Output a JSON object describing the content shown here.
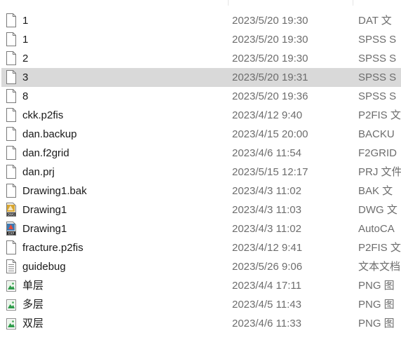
{
  "files": [
    {
      "name": "1",
      "date": "2023/5/20 19:30",
      "type": "DAT 文",
      "icon": "blank-file-icon",
      "selected": false
    },
    {
      "name": "1",
      "date": "2023/5/20 19:30",
      "type": "SPSS S",
      "icon": "blank-file-icon",
      "selected": false
    },
    {
      "name": "2",
      "date": "2023/5/20 19:30",
      "type": "SPSS S",
      "icon": "blank-file-icon",
      "selected": false
    },
    {
      "name": "3",
      "date": "2023/5/20 19:31",
      "type": "SPSS S",
      "icon": "blank-file-icon",
      "selected": true
    },
    {
      "name": "8",
      "date": "2023/5/20 19:36",
      "type": "SPSS S",
      "icon": "blank-file-icon",
      "selected": false
    },
    {
      "name": "ckk.p2fis",
      "date": "2023/4/12 9:40",
      "type": "P2FIS 文",
      "icon": "blank-file-icon",
      "selected": false
    },
    {
      "name": "dan.backup",
      "date": "2023/4/15 20:00",
      "type": "BACKU",
      "icon": "blank-file-icon",
      "selected": false
    },
    {
      "name": "dan.f2grid",
      "date": "2023/4/6 11:54",
      "type": "F2GRID",
      "icon": "blank-file-icon",
      "selected": false
    },
    {
      "name": "dan.prj",
      "date": "2023/5/15 12:17",
      "type": "PRJ 文件",
      "icon": "blank-file-icon",
      "selected": false
    },
    {
      "name": "Drawing1.bak",
      "date": "2023/4/3 11:02",
      "type": "BAK 文",
      "icon": "blank-file-icon",
      "selected": false
    },
    {
      "name": "Drawing1",
      "date": "2023/4/3 11:03",
      "type": "DWG 文",
      "icon": "dwg-file-icon",
      "selected": false
    },
    {
      "name": "Drawing1",
      "date": "2023/4/3 11:02",
      "type": "AutoCA",
      "icon": "autocad-exp-file-icon",
      "selected": false
    },
    {
      "name": "fracture.p2fis",
      "date": "2023/4/12 9:41",
      "type": "P2FIS 文",
      "icon": "blank-file-icon",
      "selected": false
    },
    {
      "name": "guidebug",
      "date": "2023/5/26 9:06",
      "type": "文本文档",
      "icon": "text-file-icon",
      "selected": false
    },
    {
      "name": "单层",
      "date": "2023/4/4 17:11",
      "type": "PNG 图",
      "icon": "png-image-file-icon",
      "selected": false
    },
    {
      "name": "多层",
      "date": "2023/4/5 11:43",
      "type": "PNG 图",
      "icon": "png-image-file-icon",
      "selected": false
    },
    {
      "name": "双层",
      "date": "2023/4/6 11:33",
      "type": "PNG 图",
      "icon": "png-image-file-icon",
      "selected": false
    }
  ],
  "colors": {
    "selection": "#d9d9d9",
    "name_text": "#1a1a1a",
    "secondary_text": "#6d6d6d"
  }
}
